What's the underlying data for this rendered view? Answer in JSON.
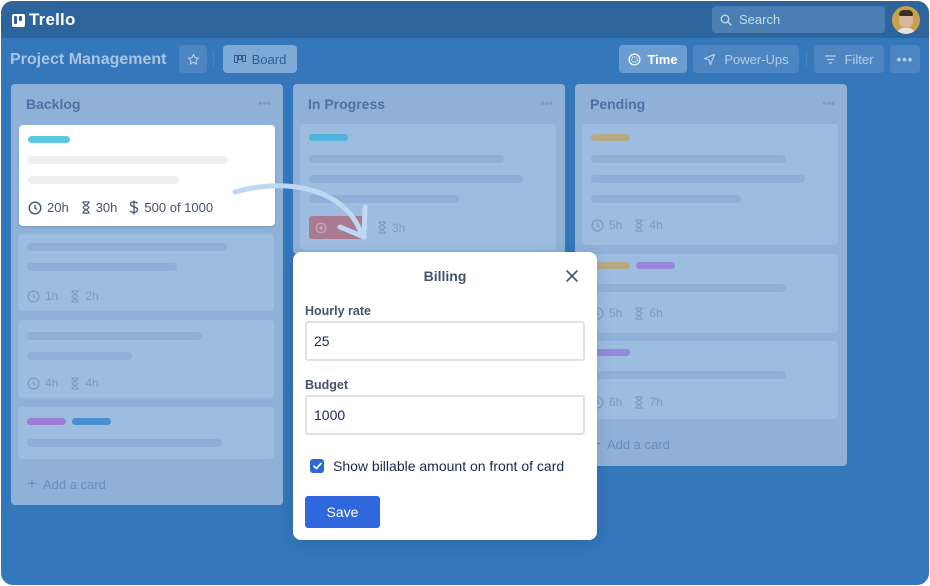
{
  "app": {
    "name": "Trello",
    "search_placeholder": "Search"
  },
  "board": {
    "title": "Project Management",
    "view_button": "Board",
    "toolbar": {
      "time": "Time",
      "power_ups": "Power-Ups",
      "filter": "Filter",
      "more": "•••"
    }
  },
  "lists": [
    {
      "title": "Backlog",
      "menu": "•••",
      "add_card": "Add a card",
      "cards": [
        {
          "labels": [
            "#5bc8e2"
          ],
          "badges": [
            {
              "icon": "clock-icon",
              "text": "20h"
            },
            {
              "icon": "hourglass-icon",
              "text": "30h"
            },
            {
              "icon": "dollar-icon",
              "text": "500 of 1000"
            }
          ]
        },
        {
          "labels": [],
          "badges": [
            {
              "icon": "clock-icon",
              "text": "1h"
            },
            {
              "icon": "hourglass-icon",
              "text": "2h"
            }
          ]
        },
        {
          "labels": [],
          "badges": [
            {
              "icon": "clock-icon",
              "text": "4h"
            },
            {
              "icon": "hourglass-icon",
              "text": "4h"
            }
          ]
        },
        {
          "labels": [
            "#9b7fd6",
            "#4a8fcf"
          ],
          "badges": []
        }
      ]
    },
    {
      "title": "In Progress",
      "menu": "•••",
      "cards": [
        {
          "labels": [
            "#4fb3dc"
          ],
          "badges": [
            {
              "icon": "timer-icon",
              "text": ""
            },
            {
              "icon": "hourglass-icon",
              "text": "3h"
            }
          ]
        }
      ]
    },
    {
      "title": "Pending",
      "menu": "•••",
      "add_card": "Add a card",
      "cards": [
        {
          "labels": [
            "#b7a887"
          ],
          "badges": [
            {
              "icon": "clock-icon",
              "text": "5h"
            },
            {
              "icon": "hourglass-icon",
              "text": "4h"
            }
          ]
        },
        {
          "labels": [
            "#b7a887",
            "#9587dc"
          ],
          "badges": [
            {
              "icon": "clock-icon",
              "text": "5h"
            },
            {
              "icon": "hourglass-icon",
              "text": "6h"
            }
          ]
        },
        {
          "labels": [
            "#9587dc"
          ],
          "badges": [
            {
              "icon": "clock-icon",
              "text": "6h"
            },
            {
              "icon": "hourglass-icon",
              "text": "7h"
            }
          ]
        }
      ]
    }
  ],
  "billing_modal": {
    "title": "Billing",
    "hourly_rate_label": "Hourly rate",
    "hourly_rate_value": "25",
    "budget_label": "Budget",
    "budget_value": "1000",
    "show_billable_label": "Show billable amount on front of card",
    "show_billable_checked": true,
    "save_label": "Save"
  },
  "colors": {
    "board_bg": "#3477bb",
    "topbar_bg": "#2c649b",
    "primary_button": "#2f67dc"
  }
}
